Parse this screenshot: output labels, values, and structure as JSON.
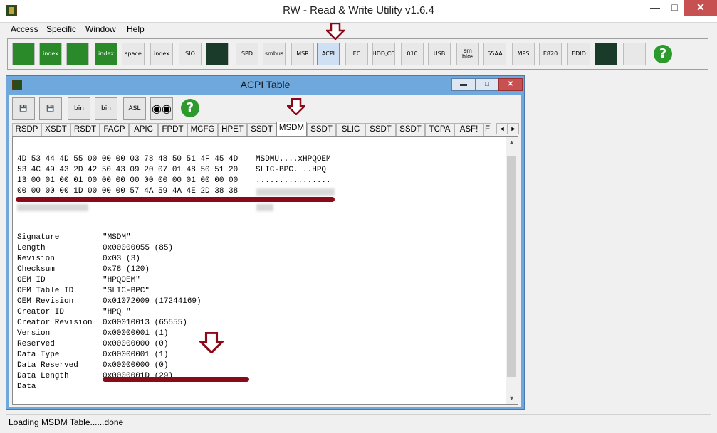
{
  "window": {
    "title": "RW - Read & Write Utility v1.6.4",
    "min_icon": "minimize-icon",
    "max_icon": "maximize-icon",
    "close_icon": "close-icon"
  },
  "menu": [
    "Access",
    "Specific",
    "Window",
    "Help"
  ],
  "toolbar": {
    "buttons": [
      {
        "name": "pci-button",
        "label": ""
      },
      {
        "name": "pci-index-button",
        "label": "index"
      },
      {
        "name": "memory-button",
        "label": ""
      },
      {
        "name": "memory-index-button",
        "label": "index"
      },
      {
        "name": "io-space-button",
        "label": "space"
      },
      {
        "name": "io-index-button",
        "label": "index"
      },
      {
        "name": "sio-button",
        "label": "SIO"
      },
      {
        "name": "scope-button",
        "label": ""
      },
      {
        "name": "spd-button",
        "label": "SPD"
      },
      {
        "name": "smbus-button",
        "label": "smbus"
      },
      {
        "name": "msr-button",
        "label": "MSR"
      },
      {
        "name": "acpi-button",
        "label": "ACPI"
      },
      {
        "name": "ec-button",
        "label": "EC"
      },
      {
        "name": "hdd-cd-button",
        "label": "HDD,CD"
      },
      {
        "name": "hex-010-button",
        "label": "010"
      },
      {
        "name": "usb-button",
        "label": "USB"
      },
      {
        "name": "smbios-button",
        "label": "sm bios"
      },
      {
        "name": "55aa-button",
        "label": "55AA"
      },
      {
        "name": "mps-button",
        "label": "MPS"
      },
      {
        "name": "e820-button",
        "label": "E820"
      },
      {
        "name": "edid-button",
        "label": "EDID"
      },
      {
        "name": "command-button",
        "label": ""
      },
      {
        "name": "battery-button",
        "label": ""
      },
      {
        "name": "help-button",
        "label": "?"
      }
    ]
  },
  "acpi_window": {
    "title": "ACPI Table",
    "toolbar": [
      "save-icon",
      "save-all-icon",
      "save-bin-icon",
      "save-all-bin-icon",
      "asl-icon",
      "find-icon",
      "help-icon"
    ],
    "toolbar_labels": {
      "bin1": "bin",
      "bin2": "bin",
      "asl": "ASL",
      "help": "?"
    },
    "tabs": [
      "RSDP",
      "XSDT",
      "RSDT",
      "FACP",
      "APIC",
      "FPDT",
      "MCFG",
      "HPET",
      "SSDT",
      "MSDM",
      "SSDT",
      "SLIC",
      "SSDT",
      "SSDT",
      "TCPA",
      "ASF!",
      "F"
    ],
    "active_tab": "MSDM",
    "hex_lines": [
      "4D 53 44 4D 55 00 00 00 03 78 48 50 51 4F 45 4D",
      "53 4C 49 43 2D 42 50 43 09 20 07 01 48 50 51 20",
      "13 00 01 00 01 00 00 00 00 00 00 00 01 00 00 00",
      "00 00 00 00 1D 00 00 00 57 4A 59 4A 4E 2D 38 38"
    ],
    "ascii_lines": [
      "MSDMU....xHPQOEM",
      "SLIC-BPC. ..HPQ",
      "................",
      ""
    ],
    "fields": [
      {
        "key": "Signature",
        "value": "\"MSDM\""
      },
      {
        "key": "Length",
        "value": "0x00000055 (85)"
      },
      {
        "key": "Revision",
        "value": "0x03 (3)"
      },
      {
        "key": "Checksum",
        "value": "0x78 (120)"
      },
      {
        "key": "OEM ID",
        "value": "\"HPQOEM\""
      },
      {
        "key": "OEM Table ID",
        "value": "\"SLIC-BPC\""
      },
      {
        "key": "OEM Revision",
        "value": "0x01072009 (17244169)"
      },
      {
        "key": "Creator ID",
        "value": "\"HPQ \""
      },
      {
        "key": "Creator Revision",
        "value": "0x00010013 (65555)"
      },
      {
        "key": "Version",
        "value": "0x00000001 (1)"
      },
      {
        "key": "Reserved",
        "value": "0x00000000 (0)"
      },
      {
        "key": "Data Type",
        "value": "0x00000001 (1)"
      },
      {
        "key": "Data Reserved",
        "value": "0x00000000 (0)"
      },
      {
        "key": "Data Length",
        "value": "0x0000001D (29)"
      },
      {
        "key": "Data",
        "value": ""
      }
    ]
  },
  "status": "Loading MSDM Table......done",
  "colors": {
    "annotation_red": "#8a0a1a",
    "title_blue": "#6fa8dc",
    "help_green": "#2d9a2d"
  }
}
